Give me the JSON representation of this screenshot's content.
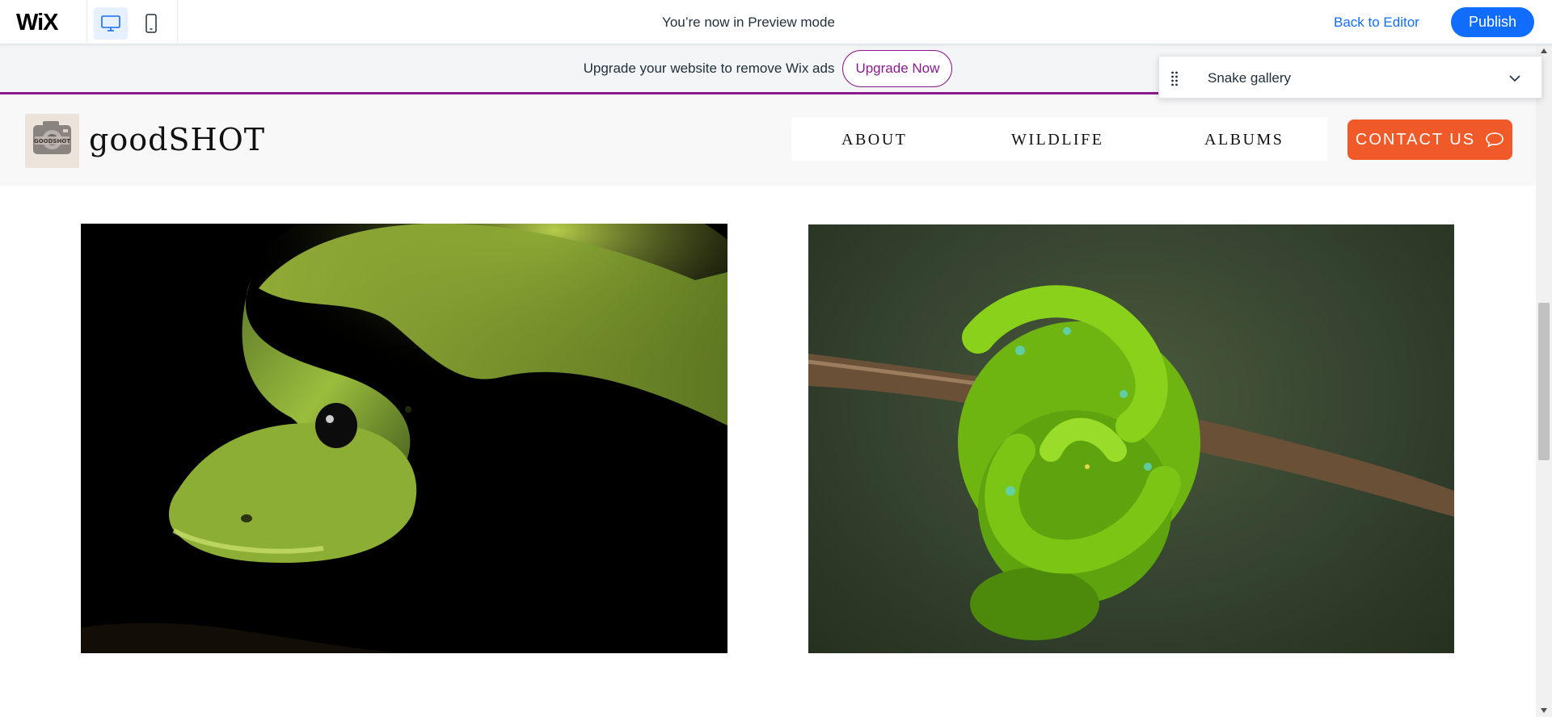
{
  "editor_bar": {
    "logo": "WiX",
    "preview_message": "You’re now in Preview mode",
    "back_to_editor": "Back to Editor",
    "publish": "Publish",
    "accent_color": "#116dff"
  },
  "banner": {
    "text": "Upgrade your website to remove Wix ads",
    "button": "Upgrade Now",
    "accent_color": "#8b1a8a"
  },
  "page_selector": {
    "current_page": "Snake gallery"
  },
  "site": {
    "brand": "goodSHOT",
    "logo_badge": "GOODSHOT",
    "nav": [
      "ABOUT",
      "WILDLIFE",
      "ALBUMS"
    ],
    "contact": "CONTACT US",
    "contact_color": "#f05a28"
  },
  "gallery": {
    "images": [
      {
        "subject": "green mamba snake close-up",
        "icon": "photo"
      },
      {
        "subject": "green tree python coiled on branch",
        "icon": "photo"
      }
    ]
  }
}
